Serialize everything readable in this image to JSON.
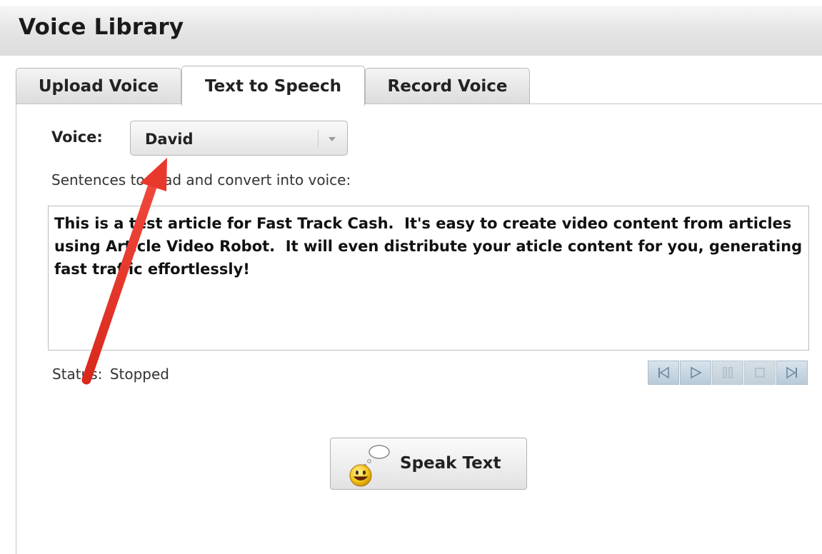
{
  "header": {
    "title": "Voice Library"
  },
  "tabs": [
    {
      "label": "Upload Voice",
      "active": false
    },
    {
      "label": "Text to Speech",
      "active": true
    },
    {
      "label": "Record Voice",
      "active": false
    }
  ],
  "voice": {
    "label": "Voice:",
    "selected": "David"
  },
  "sentences": {
    "label": "Sentences to read and convert into voice:",
    "text": "This is a test article for Fast Track Cash.  It's easy to create video content from articles using Article Video Robot.  It will even distribute your aticle content for you, generating fast traffic effortlessly!"
  },
  "status": {
    "label": "Status:",
    "value": "Stopped"
  },
  "player": {
    "buttons": [
      {
        "name": "skip-back-icon",
        "enabled": true
      },
      {
        "name": "play-icon",
        "enabled": true
      },
      {
        "name": "pause-icon",
        "enabled": false
      },
      {
        "name": "stop-icon",
        "enabled": false
      },
      {
        "name": "skip-forward-icon",
        "enabled": true
      }
    ]
  },
  "speak_button": {
    "label": "Speak Text",
    "icon": "smiley-speech-icon"
  },
  "colors": {
    "annotation_arrow": "#e8392c",
    "player_button": "#c7d5e0"
  }
}
